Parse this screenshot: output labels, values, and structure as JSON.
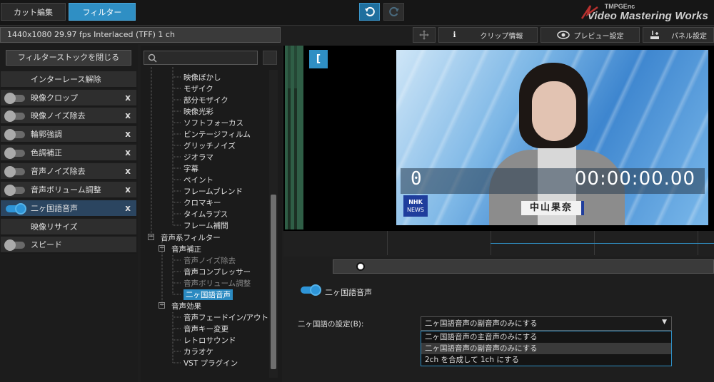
{
  "tabs": [
    {
      "label": "カット編集",
      "active": false
    },
    {
      "label": "フィルター",
      "active": true
    }
  ],
  "brand": {
    "line1": "TMPGEnc",
    "line2": "Video Mastering Works"
  },
  "infobar": {
    "text": "1440x1080 29.97 fps Interlaced (TFF)  1 ch"
  },
  "header_buttons": {
    "clip_info": "クリップ情報",
    "preview_settings": "プレビュー設定",
    "panel_settings": "パネル設定"
  },
  "left_panel": {
    "close_button": "フィルターストックを閉じる",
    "filters": [
      {
        "label": "インターレース解除",
        "toggle": false,
        "has_toggle": false,
        "removable": false,
        "selected": false
      },
      {
        "label": "映像クロップ",
        "toggle": false,
        "has_toggle": true,
        "removable": true,
        "selected": false
      },
      {
        "label": "映像ノイズ除去",
        "toggle": false,
        "has_toggle": true,
        "removable": true,
        "selected": false
      },
      {
        "label": "輪郭強調",
        "toggle": false,
        "has_toggle": true,
        "removable": true,
        "selected": false
      },
      {
        "label": "色調補正",
        "toggle": false,
        "has_toggle": true,
        "removable": true,
        "selected": false
      },
      {
        "label": "音声ノイズ除去",
        "toggle": false,
        "has_toggle": true,
        "removable": true,
        "selected": false
      },
      {
        "label": "音声ボリューム調整",
        "toggle": false,
        "has_toggle": true,
        "removable": true,
        "selected": false
      },
      {
        "label": "二ヶ国語音声",
        "toggle": true,
        "has_toggle": true,
        "removable": true,
        "selected": true
      },
      {
        "label": "映像リサイズ",
        "toggle": false,
        "has_toggle": false,
        "removable": false,
        "selected": false
      },
      {
        "label": "スピード",
        "toggle": false,
        "has_toggle": true,
        "removable": false,
        "selected": false
      }
    ],
    "remove_glyph": "x"
  },
  "tree": {
    "video_items": [
      "映像ぼかし",
      "モザイク",
      "部分モザイク",
      "映像光彩",
      "ソフトフォーカス",
      "ビンテージフィルム",
      "グリッチノイズ",
      "ジオラマ",
      "字幕",
      "ペイント",
      "フレームブレンド",
      "クロマキー",
      "タイムラプス",
      "フレーム補間"
    ],
    "audio_group": "音声系フィルター",
    "audio_fix_group": "音声補正",
    "audio_fix_items": [
      {
        "label": "音声ノイズ除去",
        "state": "dim"
      },
      {
        "label": "音声コンプレッサー",
        "state": "normal"
      },
      {
        "label": "音声ボリューム調整",
        "state": "dim"
      },
      {
        "label": "二ヶ国語音声",
        "state": "highlight"
      }
    ],
    "audio_effect_group": "音声効果",
    "audio_effect_items": [
      "音声フェードイン/アウト",
      "音声キー変更",
      "レトロサウンド",
      "カラオケ",
      "VST プラグイン"
    ],
    "expand_glyph": "−"
  },
  "preview": {
    "bracket_glyph": "[",
    "frame_number": "0",
    "timecode": "00:00:00.00",
    "caption_name": "中山果奈",
    "logo_top": "NHK",
    "logo_bottom": "NEWS"
  },
  "properties": {
    "filter_name": "二ヶ国語音声",
    "setting_label": "二ヶ国語の設定(B):",
    "selected_value": "二ヶ国語音声の副音声のみにする",
    "options": [
      "二ヶ国語音声の主音声のみにする",
      "二ヶ国語音声の副音声のみにする",
      "2ch を合成して 1ch にする"
    ],
    "dropdown_arrow": "▼"
  },
  "colors": {
    "accent": "#2f8fc4",
    "selected_row": "#2b4560",
    "tree_highlight": "#2b8ac1"
  }
}
